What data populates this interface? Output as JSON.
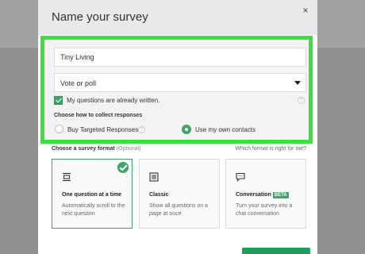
{
  "background": {
    "title": ""
  },
  "modal": {
    "title": "Name your survey",
    "close_glyph": "×",
    "name_input": {
      "value": "Tiny Living",
      "placeholder": ""
    },
    "type_select": {
      "value": "Vote or poll"
    },
    "questions_written": {
      "label": "My questions are already written.",
      "checked": true
    },
    "collect": {
      "heading": "Choose how to collect responses",
      "options": [
        {
          "label": "Buy Targeted Responses",
          "selected": false
        },
        {
          "label": "Use my own contacts",
          "selected": true
        }
      ]
    },
    "format": {
      "heading": "Choose a survey format",
      "optional": "(Optional)",
      "help_link": "Which format is right for me?",
      "cards": [
        {
          "title": "One question at a time",
          "desc": "Automatically scroll to the next question",
          "icon": "one-question-icon",
          "selected": true
        },
        {
          "title": "Classic",
          "desc": "Show all questions on a page at once",
          "icon": "classic-page-icon",
          "selected": false
        },
        {
          "title": "Conversation",
          "badge": "BETA",
          "desc": "Turn your survey into a chat conversation",
          "icon": "chat-bubble-icon",
          "selected": false
        }
      ]
    }
  },
  "colors": {
    "highlight": "#38e040",
    "accent": "#3aa66a",
    "button": "#1f9e5a"
  }
}
